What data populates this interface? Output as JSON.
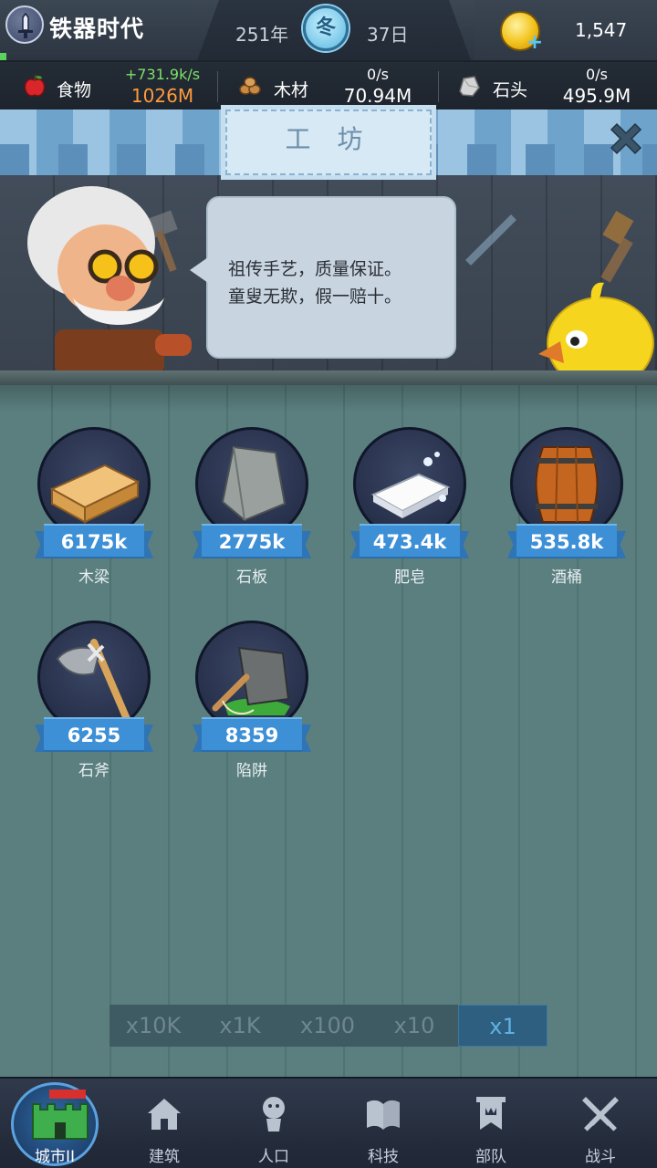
{
  "header": {
    "era_name": "铁器时代",
    "year": "251年",
    "season": "冬",
    "day": "37日",
    "coins": "1,547"
  },
  "resources": [
    {
      "label": "食物",
      "rate": "+731.9k/s",
      "amount": "1026M",
      "rate_color": "#7ee06a",
      "amount_color": "#ff9a3c"
    },
    {
      "label": "木材",
      "rate": "0/s",
      "amount": "70.94M"
    },
    {
      "label": "石头",
      "rate": "0/s",
      "amount": "495.9M"
    }
  ],
  "workshop": {
    "title": "工 坊",
    "speech_lines": [
      "祖传手艺，质量保证。",
      "童叟无欺，假一赔十。"
    ]
  },
  "items": [
    {
      "name": "木梁",
      "value": "6175k",
      "icon": "wood-beam-icon"
    },
    {
      "name": "石板",
      "value": "2775k",
      "icon": "stone-slab-icon"
    },
    {
      "name": "肥皂",
      "value": "473.4k",
      "icon": "soap-icon"
    },
    {
      "name": "酒桶",
      "value": "535.8k",
      "icon": "barrel-icon"
    },
    {
      "name": "石斧",
      "value": "6255",
      "icon": "stone-axe-icon"
    },
    {
      "name": "陷阱",
      "value": "8359",
      "icon": "trap-icon"
    }
  ],
  "multiplier": {
    "options": [
      "x10K",
      "x1K",
      "x100",
      "x10",
      "x1"
    ],
    "selected": "x1"
  },
  "nav": [
    {
      "label": "城市II",
      "icon": "castle-icon",
      "active": true
    },
    {
      "label": "建筑",
      "icon": "house-icon"
    },
    {
      "label": "人口",
      "icon": "person-icon"
    },
    {
      "label": "科技",
      "icon": "book-icon"
    },
    {
      "label": "部队",
      "icon": "banner-icon"
    },
    {
      "label": "战斗",
      "icon": "crossed-swords-icon"
    }
  ]
}
